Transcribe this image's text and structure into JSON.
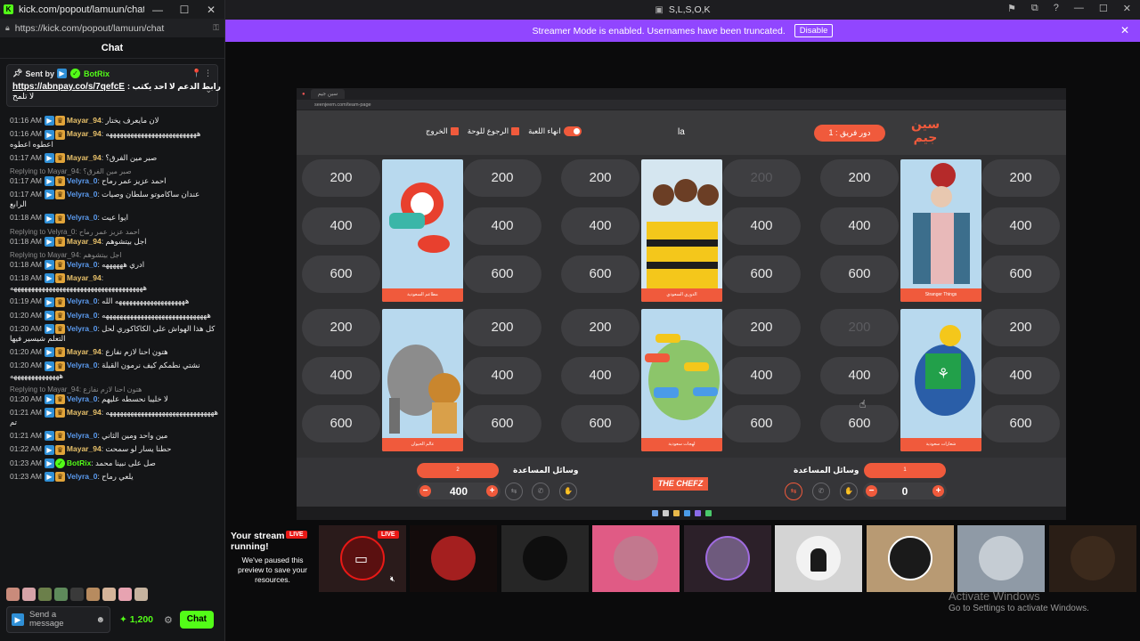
{
  "chat_window": {
    "title": "kick.com/popout/lamuun/chat - ...",
    "url": "https://kick.com/popout/lamuun/chat",
    "header": "Chat",
    "pinned": {
      "sent_by": "Sent by",
      "bot_name": "BotRix",
      "link": "https://abnpay.co/s/7qefcE",
      "link_suffix": ": رابط الدعم لا احد يكتب",
      "tail": "لا تلمح"
    },
    "messages": [
      {
        "time": "01:16 AM",
        "user": "Mayar_94",
        "color": "#e7c06a",
        "text": "لان مايعرف يختار"
      },
      {
        "time": "01:16 AM",
        "user": "Mayar_94",
        "color": "#e7c06a",
        "text": "ههههههههههههههههههههههههههه اعطوه اعطوه"
      },
      {
        "time": "01:17 AM",
        "user": "Mayar_94",
        "color": "#e7c06a",
        "text": "صبر مين الفرق؟"
      },
      {
        "reply": "Replying to Mayar_94: صبر مين الفرق؟",
        "time": "01:17 AM",
        "user": "Velyra_0",
        "color": "#5b9bf0",
        "text": "احمد عزيز عمر رماح"
      },
      {
        "time": "01:17 AM",
        "user": "Velyra_0",
        "color": "#5b9bf0",
        "text": "عندان ساكاموتو سلطان وصيات الرابع"
      },
      {
        "time": "01:18 AM",
        "user": "Velyra_0",
        "color": "#5b9bf0",
        "text": "ايوا عيت"
      },
      {
        "reply": "Replying to Velyra_0: احمد عزيز عمر رماح",
        "time": "01:18 AM",
        "user": "Mayar_94",
        "color": "#e7c06a",
        "text": "اجل بيتشوهم"
      },
      {
        "reply": "Replying to Mayar_94: اجل بيتشوهم",
        "time": "01:18 AM",
        "user": "Velyra_0",
        "color": "#5b9bf0",
        "text": "ادري ههههههه"
      },
      {
        "time": "01:18 AM",
        "user": "Mayar_94",
        "color": "#e7c06a",
        "text": "ههههههههههههههههههههههههههههههههههههههه"
      },
      {
        "time": "01:19 AM",
        "user": "Velyra_0",
        "color": "#5b9bf0",
        "text": "ههههههههههههههههههههه الله"
      },
      {
        "time": "01:20 AM",
        "user": "Velyra_0",
        "color": "#5b9bf0",
        "text": "ههههههههههههههههههههههههههههههه"
      },
      {
        "time": "01:20 AM",
        "user": "Velyra_0",
        "color": "#5b9bf0",
        "text": "كل هذا الهواش على الكاكاكوري لحل التعلم شيسير فيها"
      },
      {
        "time": "01:20 AM",
        "user": "Mayar_94",
        "color": "#e7c06a",
        "text": "هتون احنا لازم نفازع"
      },
      {
        "time": "01:20 AM",
        "user": "Velyra_0",
        "color": "#5b9bf0",
        "text": "نشتي نطمكم كيف نرمون القبلة ههههههههههههههه"
      },
      {
        "reply": "Replying to Mayar_94: هتون احنا لازم نفازع",
        "time": "01:20 AM",
        "user": "Velyra_0",
        "color": "#5b9bf0",
        "text": "لا خليبا نحسطه عليهم"
      },
      {
        "time": "01:21 AM",
        "user": "Mayar_94",
        "color": "#e7c06a",
        "text": "هههههههههههههههههههههههههههههههه تم"
      },
      {
        "time": "01:21 AM",
        "user": "Velyra_0",
        "color": "#5b9bf0",
        "text": "مين واحد ومين الثاني"
      },
      {
        "time": "01:22 AM",
        "user": "Mayar_94",
        "color": "#e7c06a",
        "text": "حطنا يسار لو سمحت"
      },
      {
        "time": "01:23 AM",
        "user": "BotRix",
        "color": "#53fc18",
        "text": "صل على نبينا محمد"
      },
      {
        "time": "01:23 AM",
        "user": "Velyra_0",
        "color": "#5b9bf0",
        "text": "يلعي رماح"
      }
    ],
    "send_placeholder": "Send a message",
    "points": "1,200",
    "chat_button": "Chat"
  },
  "main": {
    "title": "S,L,S,O,K",
    "banner_text": "Streamer Mode is enabled. Usernames have been truncated.",
    "banner_button": "Disable",
    "stream": {
      "tab_label": "سين جيم",
      "address": "seenjeem.com/team-page",
      "turn_label": "دور فريق : 1",
      "center_text": "la",
      "logo": "سين جيم",
      "buttons": {
        "end": "انهاء اللعبة",
        "back": "الرجوع للوحة",
        "exit": "الخروج"
      },
      "categories": [
        {
          "name": "مطاعم السعودية"
        },
        {
          "name": "الدوري السعودي"
        },
        {
          "name": "Stranger Things"
        },
        {
          "name": "عالم الحيوان"
        },
        {
          "name": "لهجات سعودية"
        },
        {
          "name": "شعارات سعودية"
        }
      ],
      "values": [
        "200",
        "400",
        "600"
      ],
      "used": [
        "g2-row0-right",
        "g3-row3-left"
      ],
      "team_left": {
        "label": "وسائل المساعدة",
        "pill": "2",
        "score": "400"
      },
      "team_right": {
        "label": "وسائل المساعدة",
        "pill": "1",
        "score": "0"
      },
      "sponsor": "THE CHEFZ"
    },
    "live_strip": {
      "paused_title": "Your stream is running!",
      "paused_text": "We've paused this preview to save your resources.",
      "live": "LIVE"
    },
    "activate_title": "Activate Windows",
    "activate_text": "Go to Settings to activate Windows."
  }
}
